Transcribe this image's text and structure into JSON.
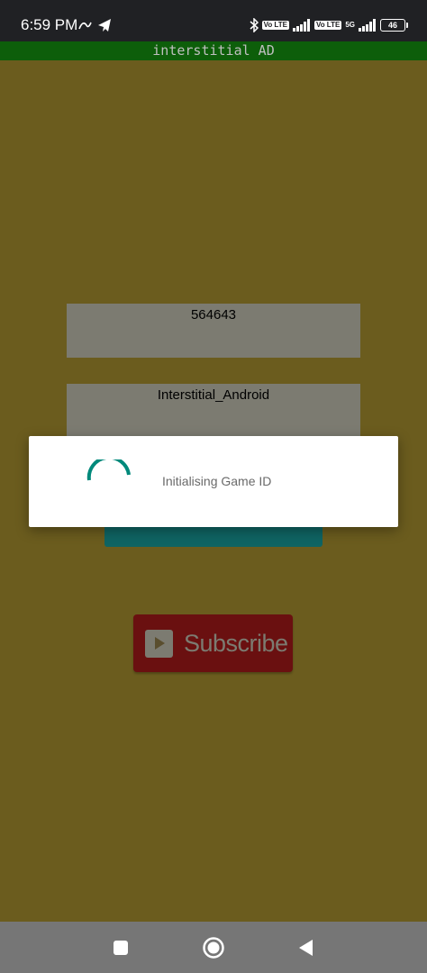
{
  "status_bar": {
    "time": "6:59 PM",
    "left_icons": [
      "signal-app-icon",
      "telegram-icon"
    ],
    "right_icons": [
      "bluetooth-icon",
      "volte-icon",
      "signal-icon",
      "volte-icon",
      "5g-signal-icon",
      "battery-icon"
    ],
    "volte_label": "Vo LTE",
    "network_5g": "5G",
    "battery_level": "46"
  },
  "app_bar": {
    "title": "interstitial AD"
  },
  "form": {
    "game_id_value": "564643",
    "placement_value": "Interstitial_Android"
  },
  "subscribe": {
    "label": "Subscribe",
    "icon": "play-icon"
  },
  "dialog": {
    "message": "Initialising Game ID",
    "spinner_color": "#00897b"
  },
  "nav_bar": {
    "buttons": [
      "recents-icon",
      "home-icon",
      "back-icon"
    ]
  },
  "colors": {
    "background": "#6b5c1e",
    "app_bar": "#0d5e0a",
    "teal_button": "#0f6463",
    "subscribe_button": "#6a1010"
  }
}
